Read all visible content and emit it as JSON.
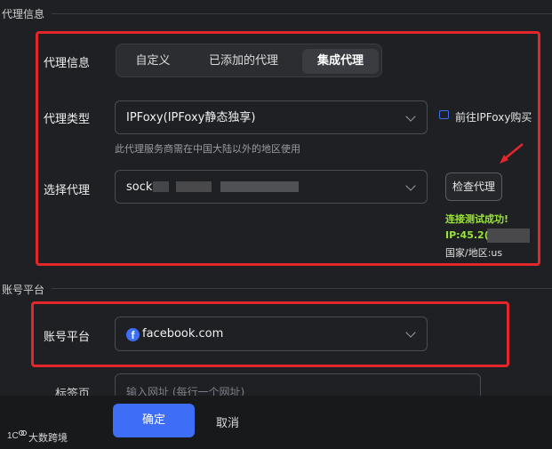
{
  "proxy_section": {
    "title": "代理信息"
  },
  "proxy_info": {
    "label": "代理信息",
    "tabs": [
      "自定义",
      "已添加的代理",
      "集成代理"
    ],
    "active_tab": "集成代理"
  },
  "proxy_type": {
    "label": "代理类型",
    "value": "IPFoxy(IPFoxy静态独享)",
    "hint": "此代理服务商需在中国大陆以外的地区使用",
    "buy_link": "前往IPFoxy购买"
  },
  "select_proxy": {
    "label": "选择代理",
    "value": "sock",
    "check_button": "检查代理",
    "result_success": "连接测试成功!",
    "result_ip": "IP:45.2(",
    "result_region": "国家/地区:us"
  },
  "account_section": {
    "title": "账号平台"
  },
  "account_platform": {
    "label": "账号平台",
    "value": "facebook.com",
    "icon": "facebook-icon"
  },
  "tags": {
    "label": "标签页",
    "placeholder": "输入网址 (每行一个网址)"
  },
  "footer": {
    "confirm": "确定",
    "cancel": "取消",
    "watermark": "大数跨境"
  },
  "colors": {
    "background": "#1f2023",
    "highlight_border": "#e3262b",
    "primary_button": "#3f6ef6",
    "success_text": "#9be23d",
    "link_icon": "#3d6ff5"
  }
}
